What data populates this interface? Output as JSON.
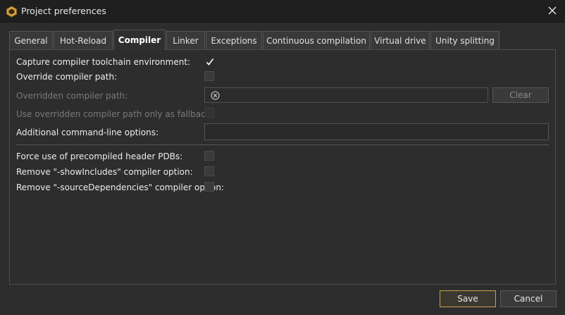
{
  "window": {
    "title": "Project preferences",
    "app_icon": "hexagon-app-icon",
    "close_icon": "close-icon"
  },
  "tabs": [
    {
      "label": "General",
      "active": false
    },
    {
      "label": "Hot-Reload",
      "active": false
    },
    {
      "label": "Compiler",
      "active": true
    },
    {
      "label": "Linker",
      "active": false
    },
    {
      "label": "Exceptions",
      "active": false
    },
    {
      "label": "Continuous compilation",
      "active": false
    },
    {
      "label": "Virtual drive",
      "active": false
    },
    {
      "label": "Unity splitting",
      "active": false
    }
  ],
  "compiler": {
    "capture_toolchain": {
      "label": "Capture compiler toolchain environment:",
      "checked": true
    },
    "override_path": {
      "label": "Override compiler path:",
      "checked": false
    },
    "overridden_path": {
      "label": "Overridden compiler path:",
      "value": "",
      "clear_label": "Clear",
      "enabled": false
    },
    "fallback_only": {
      "label": "Use overridden compiler path only as fallback:",
      "checked": false,
      "enabled": false
    },
    "additional_options": {
      "label": "Additional command-line options:",
      "value": ""
    },
    "force_pch_pdbs": {
      "label": "Force use of precompiled header PDBs:",
      "checked": false
    },
    "remove_show_includes": {
      "label": "Remove \"-showIncludes\" compiler option:",
      "checked": false
    },
    "remove_source_deps": {
      "label": "Remove \"-sourceDependencies\" compiler option:",
      "checked": false
    }
  },
  "footer": {
    "save_label": "Save",
    "cancel_label": "Cancel"
  },
  "colors": {
    "background": "#2d2d2d",
    "titlebar": "#1f1f1f",
    "accent": "#c7a24a"
  }
}
